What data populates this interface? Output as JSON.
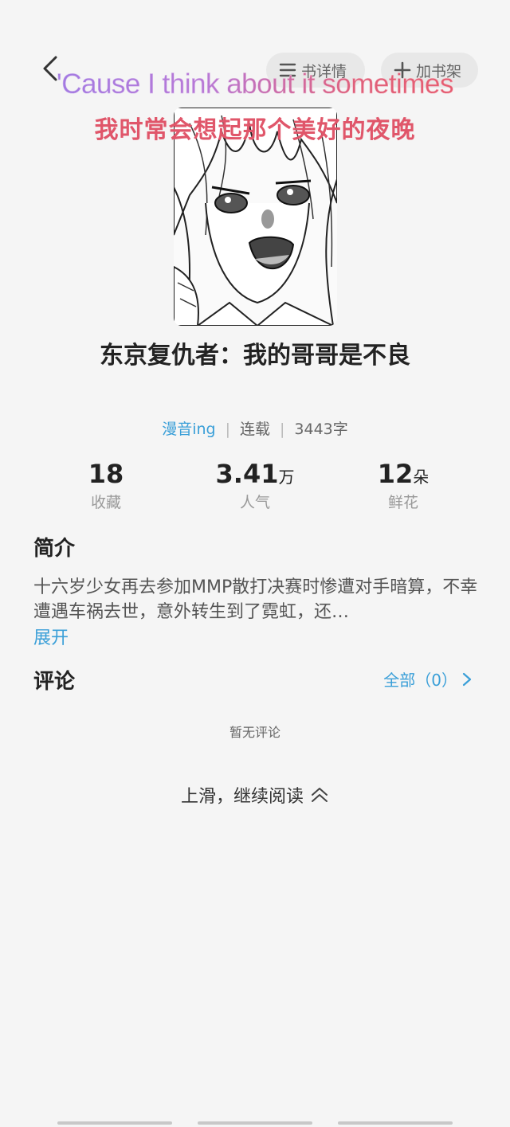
{
  "header": {
    "back_icon": "chevron-left-icon",
    "details_label": "书详情",
    "details_icon": "menu-lines-icon",
    "shelf_label": "加书架",
    "shelf_icon": "plus-icon"
  },
  "lyrics": {
    "english": "'Cause I think about it sometimes",
    "chinese": "我时常会想起那个美好的夜晚"
  },
  "book": {
    "title": "东京复仇者：我的哥哥是不良",
    "author": "漫音ing",
    "status": "连载",
    "word_count": "3443字"
  },
  "stats": [
    {
      "value": "18",
      "unit": "",
      "label": "收藏"
    },
    {
      "value": "3.41",
      "unit": "万",
      "label": "人气"
    },
    {
      "value": "12",
      "unit": "朵",
      "label": "鲜花"
    }
  ],
  "intro": {
    "heading": "简介",
    "text": "十六岁少女再去参加MMP散打决赛时惨遭对手暗算，不幸遭遇车祸去世，意外转生到了霓虹，还…",
    "expand_label": "展开"
  },
  "comments": {
    "heading": "评论",
    "all_label": "全部（0）",
    "empty_text": "暂无评论"
  },
  "footer": {
    "continue_label": "上滑，继续阅读",
    "continue_icon": "double-chevron-up-icon"
  },
  "colors": {
    "accent": "#3a9fd8",
    "lyric_red": "#e0566a",
    "lyric_purple": "#9b7be6",
    "background": "#f5f5f5"
  }
}
